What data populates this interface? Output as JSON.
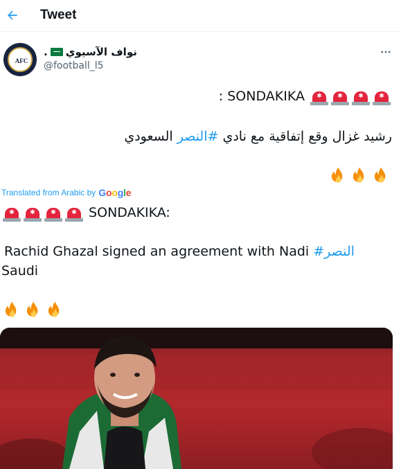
{
  "header": {
    "title": "Tweet"
  },
  "author": {
    "display_name": "نواف الآسيوي",
    "name_suffix": ".",
    "handle": "@football_l5",
    "avatar_text": "AFC"
  },
  "tweet": {
    "original_headline": ": SONDAKIKA",
    "original_body_before": "رشيد غزال وقع إتفاقية مع نادي ",
    "original_hashtag": "#النصر",
    "original_body_after": " السعودي",
    "translated_by": "Translated from Arabic by",
    "translator": "Google",
    "translated_headline": "SONDAKIKA:",
    "translated_body_before": "Rachid Ghazal signed an agreement with Nadi ",
    "translated_hashtag": "#النصر",
    "translated_body_line2": "Saudi"
  },
  "colors": {
    "accent": "#1d9bf0",
    "text": "#0f1419",
    "secondary": "#536471",
    "siren": "#e4243d",
    "photo": "#b3282c"
  },
  "icons": [
    "back-arrow-icon",
    "more-icon",
    "police-siren-icon",
    "fire-icon",
    "saudi-flag-icon"
  ]
}
